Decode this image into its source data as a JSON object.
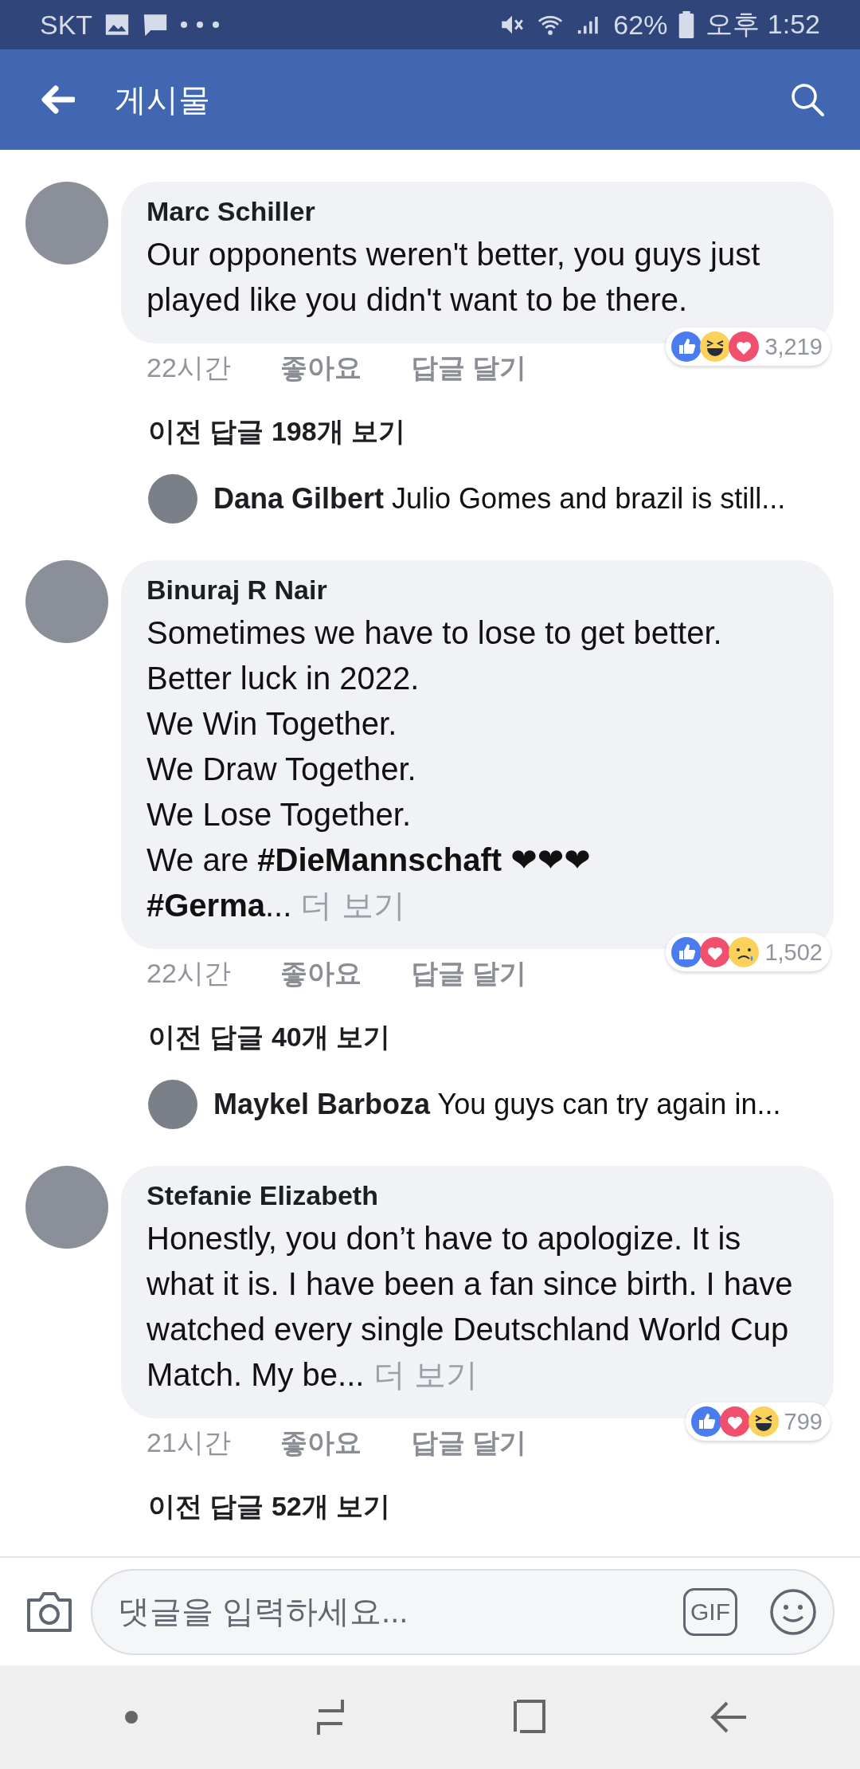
{
  "status_bar": {
    "carrier": "SKT",
    "battery": "62%",
    "time": "오후 1:52"
  },
  "header": {
    "title": "게시물"
  },
  "comments": [
    {
      "author": "Marc Schiller",
      "body": "Our opponents weren't better, you guys just played like you didn't want to be there.",
      "time": "22시간",
      "like": "좋아요",
      "reply": "답글 달기",
      "reactions": [
        {
          "kind": "like"
        },
        {
          "kind": "haha"
        },
        {
          "kind": "love"
        }
      ],
      "reaction_count": "3,219",
      "replies_link": "이전 답글 198개 보기",
      "latest_reply": {
        "author": "Dana Gilbert",
        "text": "Julio Gomes and brazil is still..."
      }
    },
    {
      "author": "Binuraj R Nair",
      "body": "Sometimes we have to lose to get better. Better luck in 2022.\nWe Win Together.\nWe Draw Together.\nWe Lose Together.\nWe are  **#DieMannschaft** ❤❤❤\n**#Germa**...",
      "more": "더 보기",
      "time": "22시간",
      "like": "좋아요",
      "reply": "답글 달기",
      "reactions": [
        {
          "kind": "like"
        },
        {
          "kind": "love"
        },
        {
          "kind": "sad"
        }
      ],
      "reaction_count": "1,502",
      "replies_link": "이전 답글 40개 보기",
      "latest_reply": {
        "author": "Maykel Barboza",
        "text": "You guys can try again in..."
      }
    },
    {
      "author": "Stefanie Elizabeth",
      "body": "Honestly, you don’t have to apologize. It is what it is. I have been a fan since birth. I have watched every single Deutschland World Cup Match. My be...",
      "more": "더 보기",
      "time": "21시간",
      "like": "좋아요",
      "reply": "답글 달기",
      "reactions": [
        {
          "kind": "like"
        },
        {
          "kind": "love"
        },
        {
          "kind": "haha"
        }
      ],
      "reaction_count": "799",
      "replies_link": "이전 답글 52개 보기"
    }
  ],
  "composer": {
    "placeholder": "댓글을 입력하세요...",
    "gif": "GIF"
  }
}
